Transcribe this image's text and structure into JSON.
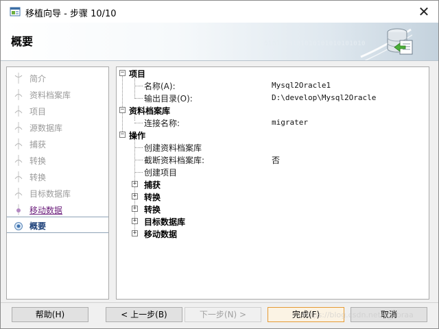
{
  "window": {
    "title": "移植向导 - 步骤 10/10"
  },
  "banner": {
    "heading": "概要",
    "binary_text": "0101010101010101010101010"
  },
  "steps": [
    {
      "label": "简介",
      "state": "disabled"
    },
    {
      "label": "资料档案库",
      "state": "disabled"
    },
    {
      "label": "项目",
      "state": "disabled"
    },
    {
      "label": "源数据库",
      "state": "disabled"
    },
    {
      "label": "捕获",
      "state": "disabled"
    },
    {
      "label": "转换",
      "state": "disabled"
    },
    {
      "label": "转换",
      "state": "disabled"
    },
    {
      "label": "目标数据库",
      "state": "disabled"
    },
    {
      "label": "移动数据",
      "state": "link"
    },
    {
      "label": "概要",
      "state": "current"
    }
  ],
  "summary": {
    "project": {
      "title": "项目",
      "name_label": "名称(A):",
      "name_value": "Mysql2Oracle1",
      "output_label": "输出目录(O):",
      "output_value": "D:\\develop\\Mysql2Oracle"
    },
    "repository": {
      "title": "资料档案库",
      "conn_label": "连接名称:",
      "conn_value": "migrater"
    },
    "operations": {
      "title": "操作",
      "items": [
        {
          "label": "创建资料档案库",
          "value": ""
        },
        {
          "label": "截断资料档案库:",
          "value": "否"
        },
        {
          "label": "创建项目",
          "value": ""
        }
      ],
      "groups": [
        "捕获",
        "转换",
        "转换",
        "目标数据库",
        "移动数据"
      ]
    }
  },
  "buttons": {
    "help": "帮助(H)",
    "back": "< 上一步(B)",
    "next": "下一步(N) >",
    "finish": "完成(F)",
    "cancel": "取消"
  },
  "watermark": "https://blog.csdn.net/u_abraa"
}
